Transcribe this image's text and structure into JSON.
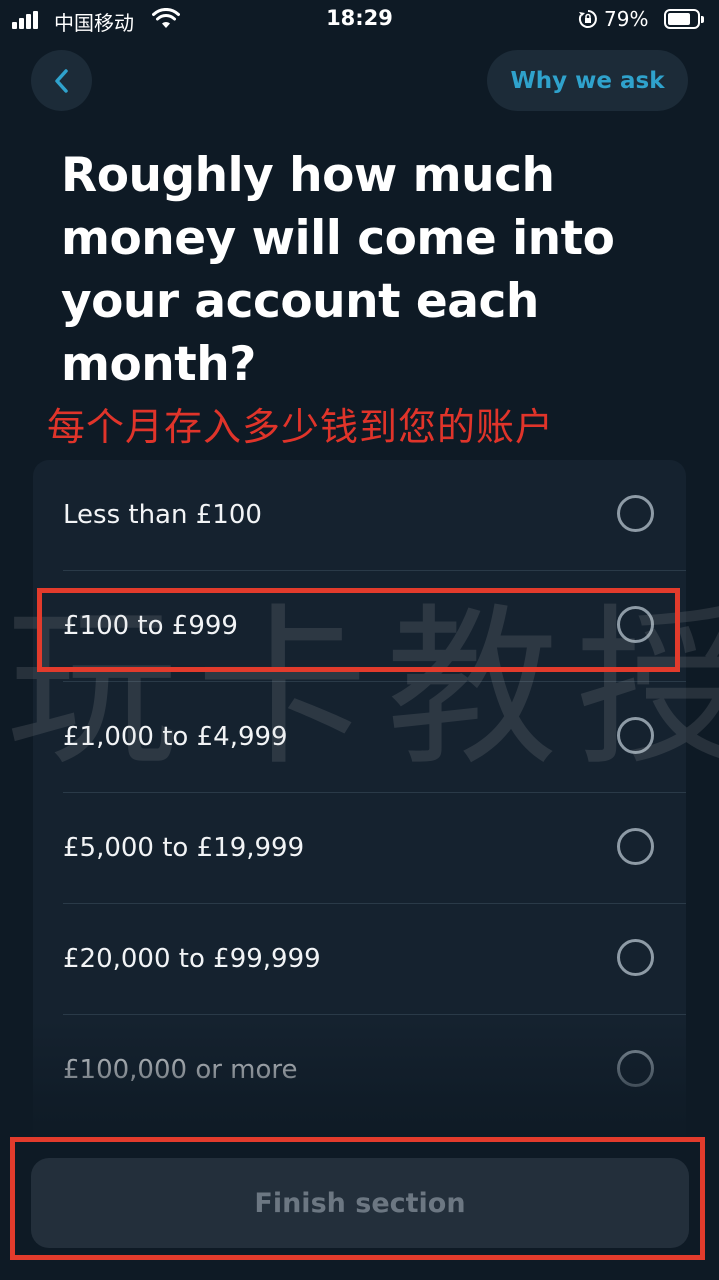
{
  "status_bar": {
    "carrier": "中国移动",
    "time": "18:29",
    "battery_percent": "79%",
    "battery_level": 0.79,
    "icons": [
      "signal-icon",
      "wifi-icon",
      "rotation-lock-icon",
      "battery-icon"
    ]
  },
  "header": {
    "back_icon": "chevron-left-icon",
    "why_label": "Why we ask"
  },
  "question": "Roughly how much money will come into your account each month?",
  "annotation": "每个月存入多少钱到您的账户",
  "options": [
    {
      "label": "Less than £100",
      "selected": false
    },
    {
      "label": "£100 to £999",
      "selected": false
    },
    {
      "label": "£1,000 to £4,999",
      "selected": false
    },
    {
      "label": "£5,000 to £19,999",
      "selected": false
    },
    {
      "label": "£20,000 to £99,999",
      "selected": false
    },
    {
      "label": "£100,000 or more",
      "selected": false
    }
  ],
  "finish_button": {
    "label": "Finish section",
    "enabled": false
  },
  "watermark": "玩卡教授",
  "colors": {
    "background": "#0e1a25",
    "card": "#15222f",
    "accent": "#2fa2cc",
    "annotation_red": "#e23b2c",
    "button_disabled": "#232f3b"
  }
}
